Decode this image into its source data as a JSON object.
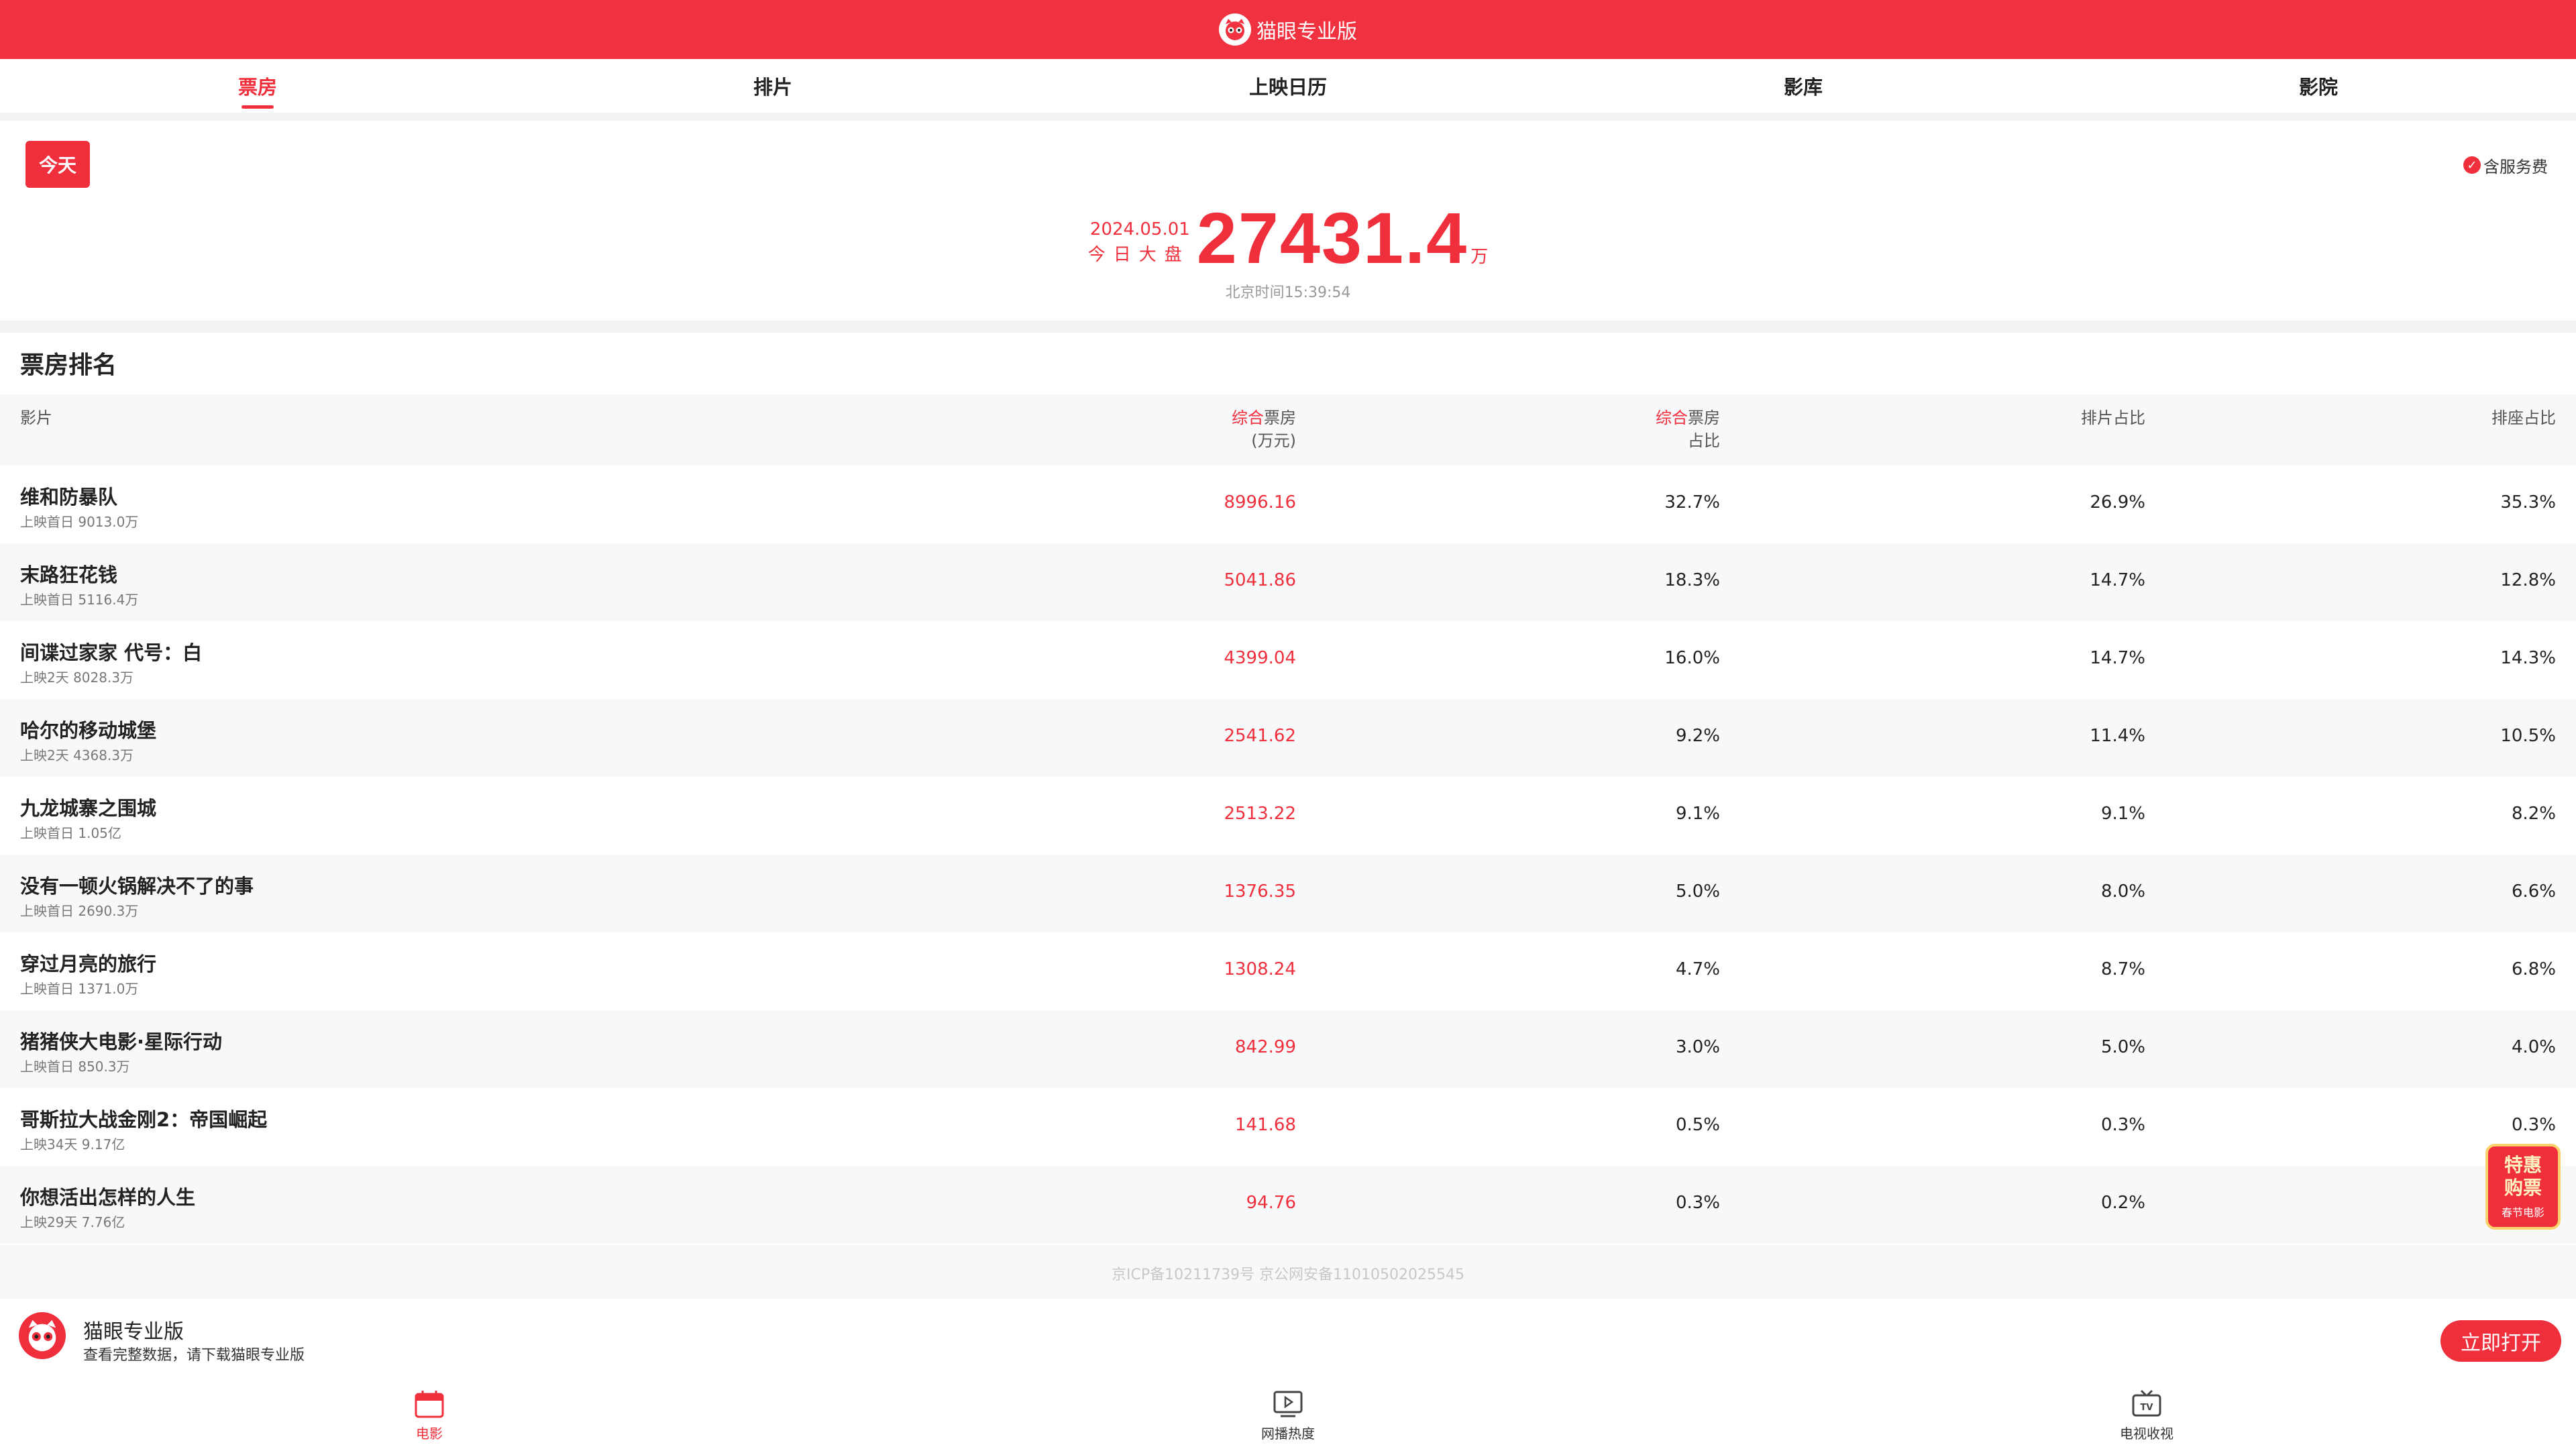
{
  "header": {
    "brand": "猫眼专业版"
  },
  "tabs": [
    {
      "label": "票房",
      "active": true
    },
    {
      "label": "排片",
      "active": false
    },
    {
      "label": "上映日历",
      "active": false
    },
    {
      "label": "影库",
      "active": false
    },
    {
      "label": "影院",
      "active": false
    }
  ],
  "summary": {
    "day_button": "今天",
    "service_fee": "含服务费",
    "date": "2024.05.01",
    "label": "今日大盘",
    "total": "27431.4",
    "unit": "万",
    "time": "北京时间15:39:54"
  },
  "ranking": {
    "title": "票房排名",
    "columns": {
      "film": "影片",
      "box_prefix": "综合",
      "box_rest": "票房",
      "box_unit": "(万元)",
      "share_prefix": "综合",
      "share_rest": "票房",
      "share_line2": "占比",
      "schedule": "排片占比",
      "seat": "排座占比"
    },
    "rows": [
      {
        "name": "维和防暴队",
        "info": "上映首日 9013.0万",
        "box": "8996.16",
        "share": "32.7%",
        "schedule": "26.9%",
        "seat": "35.3%"
      },
      {
        "name": "末路狂花钱",
        "info": "上映首日 5116.4万",
        "box": "5041.86",
        "share": "18.3%",
        "schedule": "14.7%",
        "seat": "12.8%"
      },
      {
        "name": "间谍过家家 代号：白",
        "info": "上映2天 8028.3万",
        "box": "4399.04",
        "share": "16.0%",
        "schedule": "14.7%",
        "seat": "14.3%"
      },
      {
        "name": "哈尔的移动城堡",
        "info": "上映2天 4368.3万",
        "box": "2541.62",
        "share": "9.2%",
        "schedule": "11.4%",
        "seat": "10.5%"
      },
      {
        "name": "九龙城寨之围城",
        "info": "上映首日 1.05亿",
        "box": "2513.22",
        "share": "9.1%",
        "schedule": "9.1%",
        "seat": "8.2%"
      },
      {
        "name": "没有一顿火锅解决不了的事",
        "info": "上映首日 2690.3万",
        "box": "1376.35",
        "share": "5.0%",
        "schedule": "8.0%",
        "seat": "6.6%"
      },
      {
        "name": "穿过月亮的旅行",
        "info": "上映首日 1371.0万",
        "box": "1308.24",
        "share": "4.7%",
        "schedule": "8.7%",
        "seat": "6.8%"
      },
      {
        "name": "猪猪侠大电影·星际行动",
        "info": "上映首日 850.3万",
        "box": "842.99",
        "share": "3.0%",
        "schedule": "5.0%",
        "seat": "4.0%"
      },
      {
        "name": "哥斯拉大战金刚2：帝国崛起",
        "info": "上映34天 9.17亿",
        "box": "141.68",
        "share": "0.5%",
        "schedule": "0.3%",
        "seat": "0.3%"
      },
      {
        "name": "你想活出怎样的人生",
        "info": "上映29天 7.76亿",
        "box": "94.76",
        "share": "0.3%",
        "schedule": "0.2%",
        "seat": ""
      }
    ]
  },
  "footer": {
    "icp": "京ICP备10211739号 京公网安备11010502025545"
  },
  "app_banner": {
    "name": "猫眼专业版",
    "desc": "查看完整数据，请下载猫眼专业版",
    "button": "立即打开"
  },
  "promo": {
    "line1": "特惠",
    "line2": "购票",
    "sub": "春节电影"
  },
  "bottom_nav": [
    {
      "label": "电影",
      "icon": "calendar-icon",
      "active": true
    },
    {
      "label": "网播热度",
      "icon": "play-icon",
      "active": false
    },
    {
      "label": "电视收视",
      "icon": "tv-icon",
      "active": false
    }
  ],
  "colors": {
    "accent": "#ef2f3c",
    "stripe": "#f7f8fa"
  }
}
